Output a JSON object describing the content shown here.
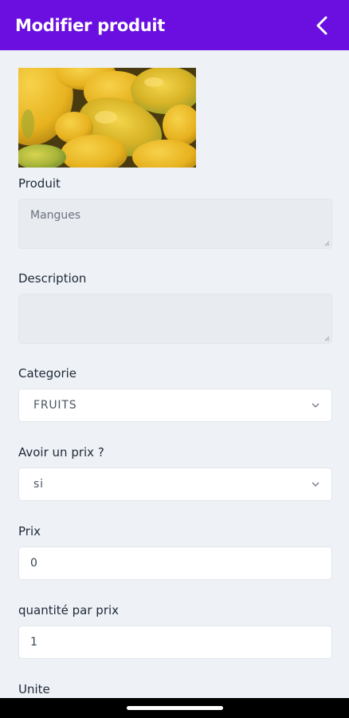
{
  "header": {
    "title": "Modifier produit",
    "back_icon": "chevron-left-icon"
  },
  "form": {
    "image_alt": "mango-photo",
    "produit": {
      "label": "Produit",
      "value": "Mangues"
    },
    "description": {
      "label": "Description",
      "value": ""
    },
    "categorie": {
      "label": "Categorie",
      "value": "FRUITS"
    },
    "avoir_prix": {
      "label": "Avoir un prix ?",
      "value": "si"
    },
    "prix": {
      "label": "Prix",
      "value": "0"
    },
    "quantite": {
      "label": "quantité par prix",
      "value": "1"
    },
    "unite": {
      "label": "Unite"
    }
  },
  "colors": {
    "appbar": "#6a0fe0",
    "background": "#eef2f7",
    "readonly_field": "#e8ebef"
  }
}
